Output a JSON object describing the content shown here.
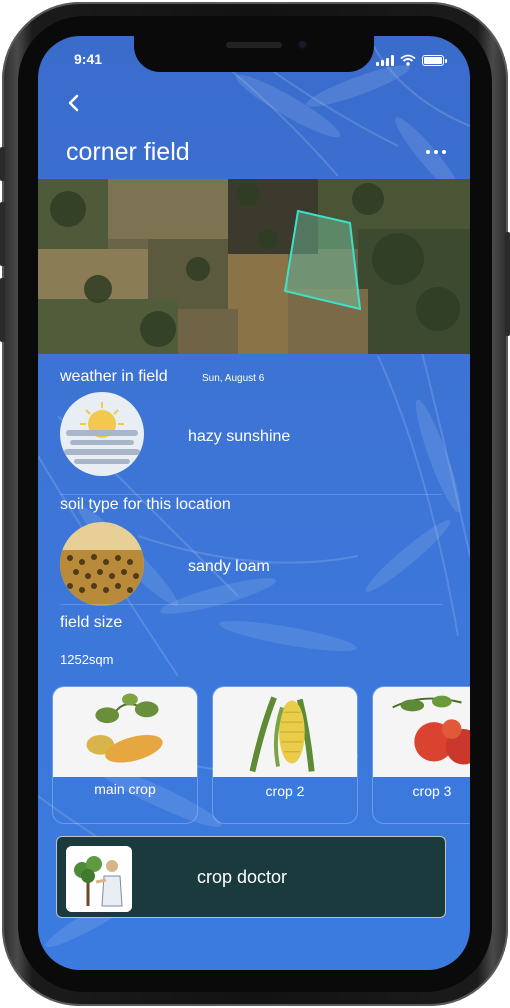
{
  "status_bar": {
    "time": "9:41"
  },
  "header": {
    "title": "corner field"
  },
  "weather": {
    "label": "weather in field",
    "date": "Sun, August 6",
    "condition": "hazy sunshine"
  },
  "soil": {
    "label": "soil type for this location",
    "type": "sandy loam"
  },
  "field_size": {
    "label": "field size",
    "value": "1252sqm"
  },
  "crops": [
    {
      "label": "main crop",
      "icon": "sweet-potato-icon"
    },
    {
      "label": "crop 2",
      "icon": "corn-icon"
    },
    {
      "label": "crop 3",
      "icon": "tomato-icon"
    }
  ],
  "doctor": {
    "label": "crop doctor",
    "icon": "plant-doctor-icon"
  },
  "colors": {
    "screen_bg": "#3d75d6",
    "doctor_bg": "#1a3a3d",
    "field_outline": "#3ee0c8"
  }
}
